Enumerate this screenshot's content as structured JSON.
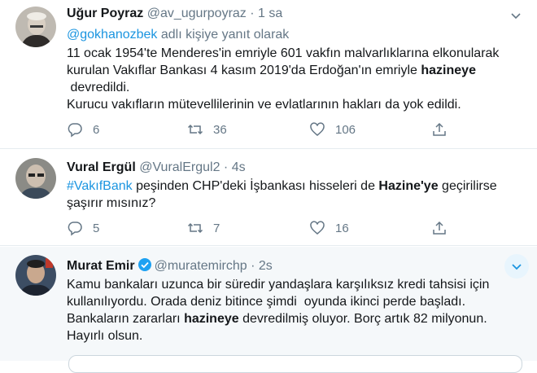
{
  "tweets": [
    {
      "name": "Uğur Poyraz",
      "handle": "@av_ugurpoyraz",
      "dot": "·",
      "time": "1 sa",
      "reply_to_handle": "@gokhanozbek",
      "reply_to_suffix": " adlı kişiye yanıt olarak",
      "line1": "11 ocak 1954'te Menderes'in emriyle 601 vakfın malvarlıklarına elkonularak",
      "line2_pre": "kurulan Vakıflar Bankası 4 kasım 2019'da Erdoğan'ın emriyle ",
      "line2_bold": "hazineye",
      "line3": " devredildi.",
      "line4": "Kurucu vakıfların mütevellilerinin ve evlatlarının hakları da yok edildi.",
      "replies": "6",
      "retweets": "36",
      "likes": "106"
    },
    {
      "name": "Vural Ergül",
      "handle": "@VuralErgul2",
      "dot": "·",
      "time": "4s",
      "hashtag": "#VakıfBank",
      "line1_mid": " peşinden CHP'deki İşbankası hisseleri de ",
      "line1_bold": "Hazine'ye",
      "line1_post": " geçirilirse",
      "line2": "şaşırır mısınız?",
      "replies": "5",
      "retweets": "7",
      "likes": "16"
    },
    {
      "name": "Murat Emir",
      "handle": "@muratemirchp",
      "dot": "·",
      "time": "2s",
      "line1": "Kamu bankaları uzunca bir süredir yandaşlara karşılıksız kredi tahsisi için",
      "line2": "kullanılıyordu. Orada deniz bitince şimdi  oyunda ikinci perde başladı.",
      "line3_pre": "Bankaların zararları ",
      "line3_bold": "hazineye",
      "line3_post": " devredilmiş oluyor. Borç artık 82 milyonun.",
      "line4": "Hayırlı olsun."
    }
  ],
  "icons": {
    "reply": "reply-icon",
    "retweet": "retweet-icon",
    "like": "heart-icon",
    "share": "share-icon",
    "caret": "chevron-down-icon",
    "verified": "verified-badge-icon"
  },
  "colors": {
    "link": "#1b95e0",
    "secondary": "#657786",
    "highlight_bg": "#f5f8fa",
    "divider": "#e6ecf0"
  }
}
